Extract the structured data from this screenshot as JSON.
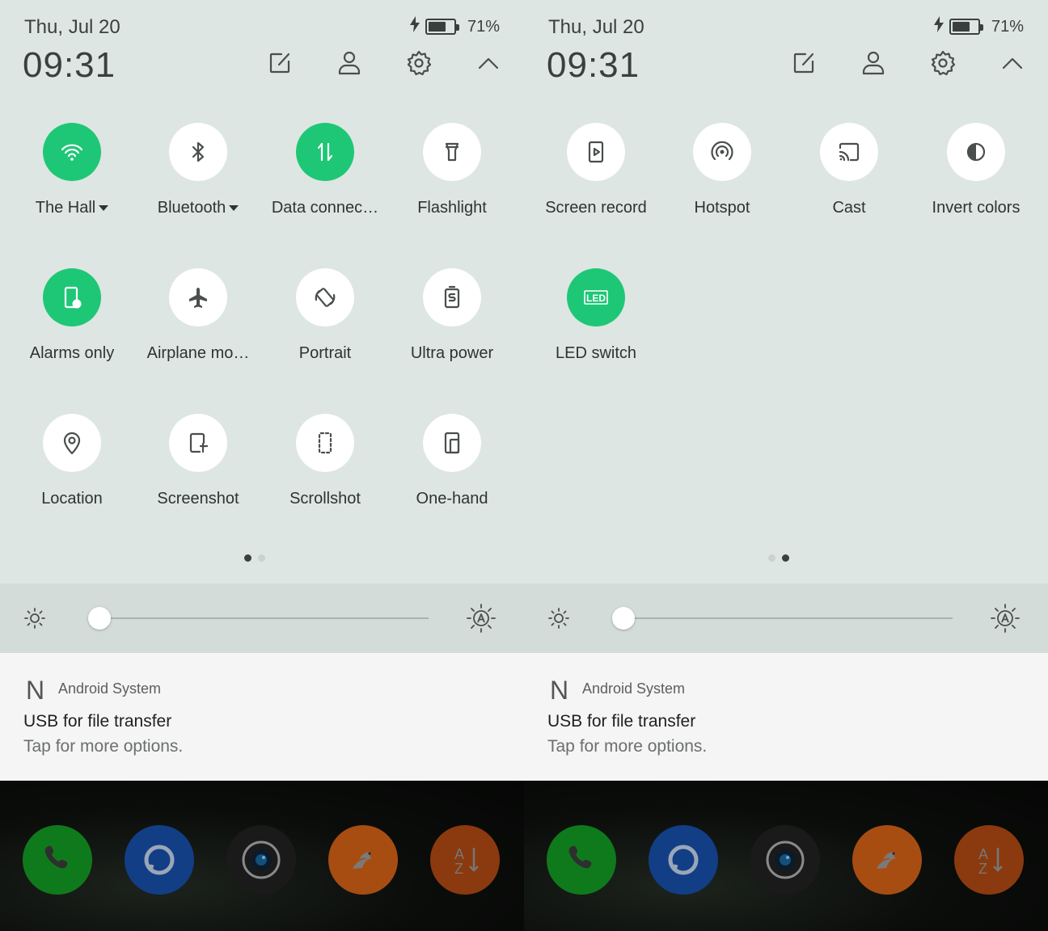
{
  "panels": [
    {
      "status": {
        "date": "Thu, Jul 20",
        "time": "09:31",
        "battery": "71%",
        "battery_level": 0.71
      },
      "header_icons": [
        "edit-icon",
        "user-icon",
        "settings-icon",
        "collapse-icon"
      ],
      "tiles": [
        {
          "label": "The Hall",
          "icon": "wifi-icon",
          "on": true,
          "dropdown": true
        },
        {
          "label": "Bluetooth",
          "icon": "bluetooth-icon",
          "on": false,
          "dropdown": true
        },
        {
          "label": "Data connec…",
          "icon": "data-icon",
          "on": true,
          "dropdown": false
        },
        {
          "label": "Flashlight",
          "icon": "flashlight-icon",
          "on": false,
          "dropdown": false
        },
        {
          "label": "Alarms only",
          "icon": "alarms-only-icon",
          "on": true,
          "dropdown": false
        },
        {
          "label": "Airplane mo…",
          "icon": "airplane-icon",
          "on": false,
          "dropdown": false
        },
        {
          "label": "Portrait",
          "icon": "rotate-icon",
          "on": false,
          "dropdown": false
        },
        {
          "label": "Ultra power",
          "icon": "ultra-power-icon",
          "on": false,
          "dropdown": false
        },
        {
          "label": "Location",
          "icon": "location-icon",
          "on": false,
          "dropdown": false
        },
        {
          "label": "Screenshot",
          "icon": "screenshot-icon",
          "on": false,
          "dropdown": false
        },
        {
          "label": "Scrollshot",
          "icon": "scrollshot-icon",
          "on": false,
          "dropdown": false
        },
        {
          "label": "One-hand",
          "icon": "one-hand-icon",
          "on": false,
          "dropdown": false
        }
      ],
      "page_indicator": {
        "pages": 2,
        "active": 0
      },
      "brightness": {
        "level": 0.02
      },
      "notification": {
        "logo": "N",
        "app": "Android System",
        "title": "USB for file transfer",
        "text": "Tap for more options."
      },
      "dock": [
        "phone-icon",
        "messages-icon",
        "camera-icon",
        "browser-icon",
        "dictionary-icon"
      ]
    },
    {
      "status": {
        "date": "Thu, Jul 20",
        "time": "09:31",
        "battery": "71%",
        "battery_level": 0.71
      },
      "header_icons": [
        "edit-icon",
        "user-icon",
        "settings-icon",
        "collapse-icon"
      ],
      "tiles": [
        {
          "label": "Screen record",
          "icon": "screen-record-icon",
          "on": false,
          "dropdown": false
        },
        {
          "label": "Hotspot",
          "icon": "hotspot-icon",
          "on": false,
          "dropdown": false
        },
        {
          "label": "Cast",
          "icon": "cast-icon",
          "on": false,
          "dropdown": false
        },
        {
          "label": "Invert colors",
          "icon": "invert-colors-icon",
          "on": false,
          "dropdown": false
        },
        {
          "label": "LED switch",
          "icon": "led-icon",
          "on": true,
          "dropdown": false
        }
      ],
      "page_indicator": {
        "pages": 2,
        "active": 1
      },
      "brightness": {
        "level": 0.02
      },
      "notification": {
        "logo": "N",
        "app": "Android System",
        "title": "USB for file transfer",
        "text": "Tap for more options."
      },
      "dock": [
        "phone-icon",
        "messages-icon",
        "camera-icon",
        "browser-icon",
        "dictionary-icon"
      ]
    }
  ],
  "colors": {
    "accent": "#1ec776",
    "panel_bg": "#dde6e3",
    "tile_bg": "#ffffff",
    "icon": "#4a4e4d"
  }
}
